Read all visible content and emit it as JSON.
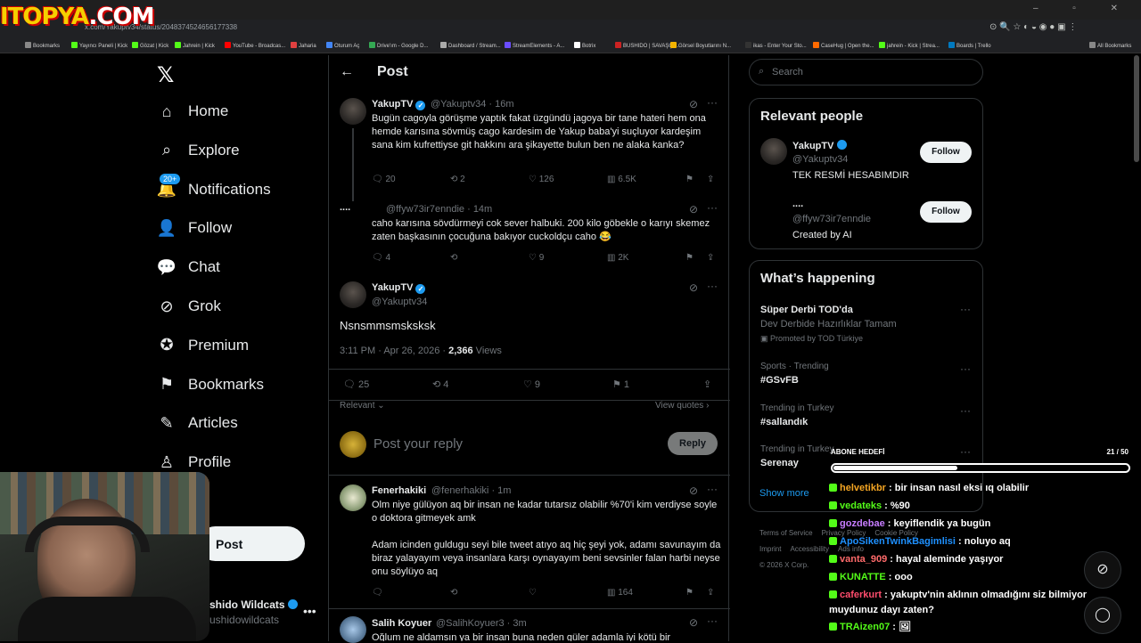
{
  "browser": {
    "url": "x.com/Yakuptv34/status/2048374524656177338",
    "bookmarks": [
      {
        "label": "Bookmarks",
        "color": "#888888"
      },
      {
        "label": "Yayıncı Paneli | Kick",
        "color": "#53fc18"
      },
      {
        "label": "Gözat | Kick",
        "color": "#53fc18"
      },
      {
        "label": "Jahrein | Kick",
        "color": "#53fc18"
      },
      {
        "label": "YouTube - Broadcas...",
        "color": "#ff0000"
      },
      {
        "label": "Jaharia",
        "color": "#e04040"
      },
      {
        "label": "Oturum Aç",
        "color": "#4285f4"
      },
      {
        "label": "Drive'ım - Google D...",
        "color": "#34a853"
      },
      {
        "label": "Dashboard / Stream...",
        "color": "#aaaaaa"
      },
      {
        "label": "StreamElements - A...",
        "color": "#6a4cff"
      },
      {
        "label": "Botrix",
        "color": "#ffffff"
      },
      {
        "label": "BUSHIDO | SAVAŞÇI...",
        "color": "#cc2222"
      },
      {
        "label": "Görsel Boyutlarını N...",
        "color": "#f4b400"
      },
      {
        "label": "ikas - Enter Your Sto...",
        "color": "#333333"
      },
      {
        "label": "CaseHug | Open the...",
        "color": "#ff6a00"
      },
      {
        "label": "jahrein - Kick | Strea...",
        "color": "#53fc18"
      },
      {
        "label": "Boards | Trello",
        "color": "#0079bf"
      },
      {
        "label": "All Bookmarks",
        "color": "#888888"
      }
    ]
  },
  "watermark": {
    "part1": "ITOPYA",
    "part2": ".COM"
  },
  "nav": {
    "items": [
      {
        "label": "Home",
        "icon": "home-icon"
      },
      {
        "label": "Explore",
        "icon": "search-icon"
      },
      {
        "label": "Notifications",
        "icon": "bell-icon",
        "badge": "20+"
      },
      {
        "label": "Follow",
        "icon": "add-user-icon"
      },
      {
        "label": "Chat",
        "icon": "chat-icon"
      },
      {
        "label": "Grok",
        "icon": "grok-icon"
      },
      {
        "label": "Premium",
        "icon": "verified-icon"
      },
      {
        "label": "Bookmarks",
        "icon": "bookmark-icon"
      },
      {
        "label": "Articles",
        "icon": "article-icon"
      },
      {
        "label": "Profile",
        "icon": "person-icon"
      },
      {
        "label": "re",
        "icon": "more-icon"
      }
    ],
    "post_label": "Post",
    "account_name": "shido Wildcats",
    "account_handle": "ushidowildcats"
  },
  "header": {
    "title": "Post"
  },
  "thread": [
    {
      "name": "YakupTV",
      "handle": "@Yakuptv34",
      "time": "· 16m",
      "text": "Bugün cagoyla görüşme yaptık fakat üzgündü jagoya bir tane hateri hem ona hemde karısına sövmüş cago kardesim de Yakup baba'yi suçluyor kardeşim sana kim kufrettiyse git hakkını ara şikayette bulun ben ne alaka kanka?",
      "replies": "20",
      "reposts": "2",
      "likes": "126",
      "views": "6.5K"
    },
    {
      "name": "....",
      "handle": "@ffyw73ir7enndie",
      "time": "· 14m",
      "text": "caho karısına sövdürmeyi cok sever halbuki. 200 kilo göbekle o karıyı skemez zaten başkasının çocuğuna bakıyor cuckoldçu caho 😂",
      "replies": "4",
      "reposts": "",
      "likes": "9",
      "views": "2K"
    }
  ],
  "main_post": {
    "name": "YakupTV",
    "handle": "@Yakuptv34",
    "text": "Nsnsmmsmsksksk",
    "timestamp": "3:11 PM · Apr 26, 2026 · ",
    "views_count": "2,366",
    "views_label": " Views",
    "replies": "25",
    "reposts": "4",
    "likes": "9",
    "bookmarks": "1"
  },
  "sort": {
    "label": "Relevant",
    "quotes": "View quotes"
  },
  "reply_box": {
    "placeholder": "Post your reply",
    "button": "Reply"
  },
  "replies": [
    {
      "name": "Fenerhakiki",
      "handle": "@fenerhakiki",
      "time": "· 1m",
      "text": "Olm niye gülüyon aq bir insan ne kadar tutarsız olabilir %70'i kim verdiyse soyle o doktora gitmeyek amk\n\nAdam icinden guldugu seyi bile tweet atıyo aq hiç şeyi yok, adamı savunayım da biraz yalayayım veya insanlara karşı oynayayım beni sevsinler falan harbi neyse onu söylüyo aq",
      "views": "164"
    },
    {
      "name": "Salih Koyuer",
      "handle": "@SalihKoyuer3",
      "time": "· 3m",
      "text": "Oğlum ne aldamsın ya bir insan buna neden güler adamla iyi kötü bir"
    }
  ],
  "right": {
    "search_placeholder": "Search",
    "relevant_title": "Relevant people",
    "people": [
      {
        "name": "YakupTV",
        "handle": "@Yakuptv34",
        "bio": "TEK RESMİ HESABIMDIR",
        "follow": "Follow"
      },
      {
        "name": "....",
        "handle": "@ffyw73ir7enndie",
        "bio": "Created by AI",
        "follow": "Follow"
      }
    ],
    "happening_title": "What’s happening",
    "trends": [
      {
        "title": "Süper Derbi TOD'da",
        "sub": "Dev Derbide Hazırlıklar Tamam",
        "promo": "Promoted by TOD Türkiye"
      },
      {
        "context": "Sports · Trending",
        "title": "#GSvFB"
      },
      {
        "context": "Trending in Turkey",
        "title": "#sallandık"
      },
      {
        "context": "Trending in Turkey",
        "title": "Serenay"
      }
    ],
    "show_more": "Show more",
    "footer": [
      "Terms of Service",
      "Privacy Policy",
      "Cookie Policy",
      "Imprint",
      "Accessibility",
      "Ads info",
      "© 2026 X Corp."
    ]
  },
  "overlay": {
    "goal_label": "ABONE HEDEFİ",
    "goal_count": "21 / 50",
    "goal_fraction": 0.42,
    "messages": [
      {
        "user": "helvetikbr",
        "text": " : bir insan nasıl eksi ıq olabilir",
        "color": "#f5a623"
      },
      {
        "user": "vedateks",
        "text": " : %90",
        "color": "#53fc18"
      },
      {
        "user": "gozdebae",
        "text": " : keyiflendik ya bugün",
        "color": "#c77dff"
      },
      {
        "user": "ApoSikenTwinkBagimlisi",
        "text": " : noluyo aq",
        "color": "#1e90ff"
      },
      {
        "user": "vanta_909",
        "text": " : hayal aleminde yaşıyor",
        "color": "#ff6b6b"
      },
      {
        "user": "KUNATTE",
        "text": " : ooo",
        "color": "#53fc18"
      },
      {
        "user": "caferkurt",
        "text": " : yakuptv'nin aklının olmadığını siz bilmiyor muydunuz dayı zaten?",
        "color": "#ff4d6d"
      },
      {
        "user": "TRAizen07",
        "text": " : 🖼",
        "color": "#53fc18"
      }
    ]
  }
}
